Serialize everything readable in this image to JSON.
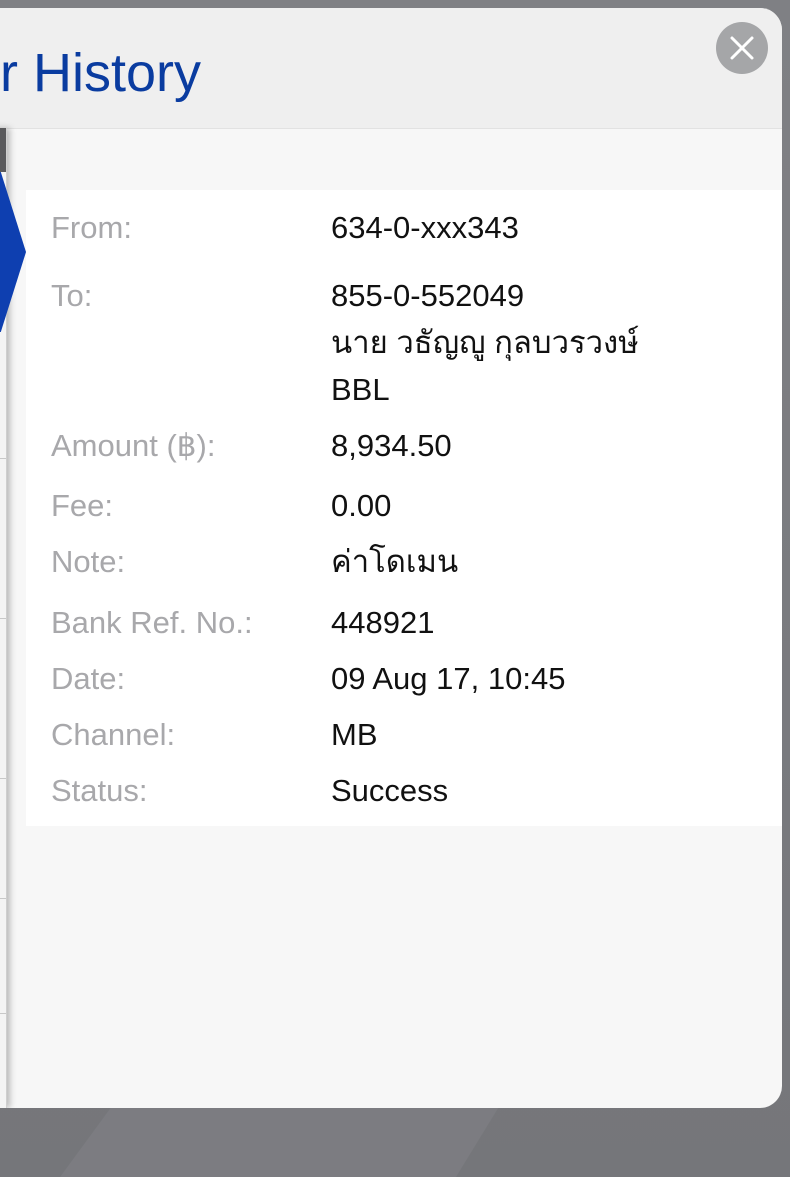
{
  "modal": {
    "title": "er History",
    "close_icon": "close-icon"
  },
  "details": {
    "from": {
      "label": "From:",
      "value": "634-0-xxx343"
    },
    "to": {
      "label": "To:",
      "account": "855-0-552049",
      "name": "นาย วธัญญู กุลบวรวงษ์",
      "bank": "BBL"
    },
    "amount": {
      "label": "Amount (฿):",
      "value": "8,934.50"
    },
    "fee": {
      "label": "Fee:",
      "value": "0.00"
    },
    "note": {
      "label": "Note:",
      "value": "ค่าโดเมน"
    },
    "bank_ref": {
      "label": "Bank Ref. No.:",
      "value": "448921"
    },
    "date": {
      "label": "Date:",
      "value": "09 Aug 17, 10:45"
    },
    "channel": {
      "label": "Channel:",
      "value": "MB"
    },
    "status": {
      "label": "Status:",
      "value": "Success"
    }
  },
  "colors": {
    "title": "#0a3ca0",
    "selected_tab": "#0e3fb0",
    "label": "#a8a8ab",
    "value": "#111111"
  }
}
